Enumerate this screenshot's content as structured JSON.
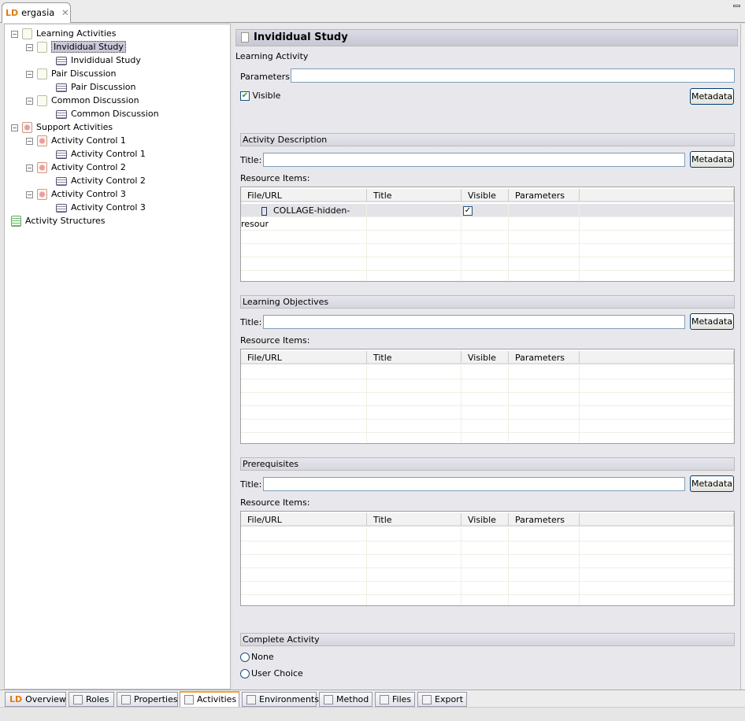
{
  "editor_tab": {
    "logo": "LD",
    "title": "ergasia"
  },
  "tree": [
    {
      "label": "Learning Activities",
      "level": 0,
      "icon": "learning-activities-icon",
      "kind": "la",
      "exp": true
    },
    {
      "label": "Invididual Study",
      "level": 1,
      "icon": "learning-activity-icon",
      "kind": "la",
      "exp": true,
      "selected": true
    },
    {
      "label": "Invididual Study",
      "level": 2,
      "icon": "environment-ref-icon",
      "kind": "res"
    },
    {
      "label": "Pair Discussion",
      "level": 1,
      "icon": "learning-activity-icon",
      "kind": "la",
      "exp": true
    },
    {
      "label": "Pair Discussion",
      "level": 2,
      "icon": "environment-ref-icon",
      "kind": "res"
    },
    {
      "label": "Common Discussion",
      "level": 1,
      "icon": "learning-activity-icon",
      "kind": "la",
      "exp": true
    },
    {
      "label": "Common Discussion",
      "level": 2,
      "icon": "environment-ref-icon",
      "kind": "res"
    },
    {
      "label": "Support Activities",
      "level": 0,
      "icon": "support-activities-icon",
      "kind": "sup",
      "exp": true
    },
    {
      "label": "Activity Control 1",
      "level": 1,
      "icon": "support-activity-icon",
      "kind": "sup",
      "exp": true
    },
    {
      "label": "Activity Control 1",
      "level": 2,
      "icon": "environment-ref-icon",
      "kind": "res"
    },
    {
      "label": "Activity Control 2",
      "level": 1,
      "icon": "support-activity-icon",
      "kind": "sup",
      "exp": true
    },
    {
      "label": "Activity Control 2",
      "level": 2,
      "icon": "environment-ref-icon",
      "kind": "res"
    },
    {
      "label": "Activity Control 3",
      "level": 1,
      "icon": "support-activity-icon",
      "kind": "sup",
      "exp": true
    },
    {
      "label": "Activity Control 3",
      "level": 2,
      "icon": "environment-ref-icon",
      "kind": "res"
    },
    {
      "label": "Activity Structures",
      "level": 0,
      "icon": "activity-structures-icon",
      "kind": "str"
    }
  ],
  "form": {
    "title": "Invididual Study",
    "subtitle": "Learning Activity",
    "parameters_label": "Parameters:",
    "parameters_value": "",
    "visible_label": "Visible",
    "visible_checked": true,
    "metadata_label": "Metadata",
    "title_label": "Title:",
    "resource_items_label": "Resource Items:",
    "columns": [
      "File/URL",
      "Title",
      "Visible",
      "Parameters"
    ],
    "sections": [
      {
        "header": "Activity Description",
        "title_value": "",
        "rows": [
          {
            "file": "COLLAGE-hidden-resour",
            "title": "",
            "visible": true,
            "parameters": ""
          }
        ]
      },
      {
        "header": "Learning Objectives",
        "title_value": "",
        "rows": []
      },
      {
        "header": "Prerequisites",
        "title_value": "",
        "rows": []
      }
    ],
    "complete_activity": {
      "header": "Complete Activity",
      "options": [
        "None",
        "User Choice"
      ],
      "selected": null
    }
  },
  "bottom_tabs": [
    {
      "label": "Overview",
      "icon": "ld-logo-icon"
    },
    {
      "label": "Roles",
      "icon": "roles-icon"
    },
    {
      "label": "Properties",
      "icon": "properties-icon"
    },
    {
      "label": "Activities",
      "icon": "activities-icon",
      "active": true
    },
    {
      "label": "Environments",
      "icon": "environments-icon"
    },
    {
      "label": "Method",
      "icon": "method-icon"
    },
    {
      "label": "Files",
      "icon": "files-icon"
    },
    {
      "label": "Export",
      "icon": "export-icon"
    }
  ]
}
